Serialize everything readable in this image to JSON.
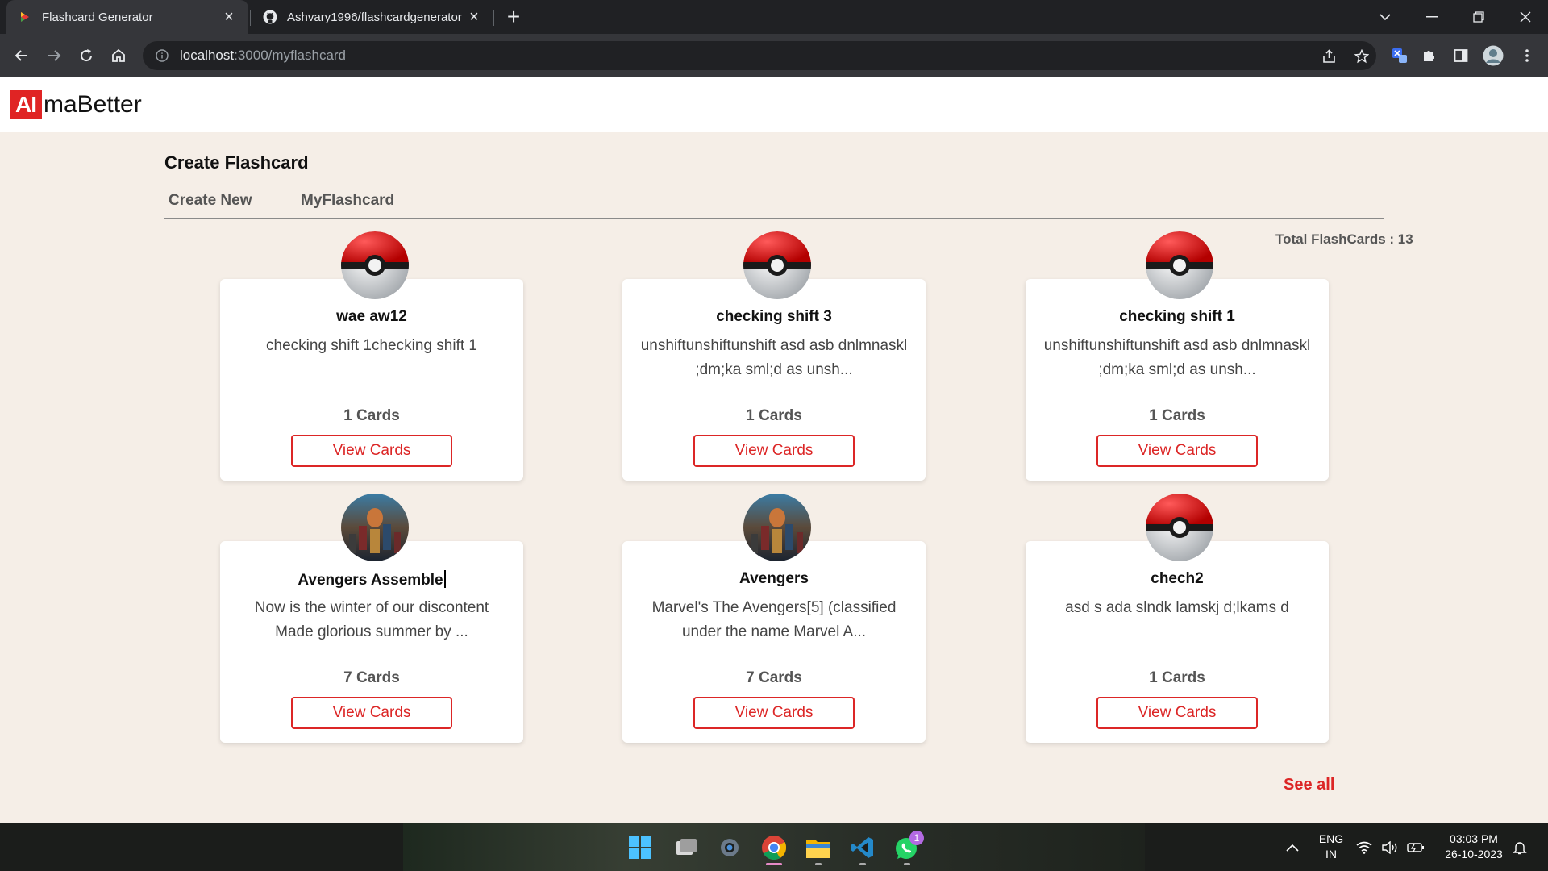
{
  "browser": {
    "tabs": [
      {
        "title": "Flashcard Generator",
        "active": true
      },
      {
        "title": "Ashvary1996/flashcardgenerator",
        "active": false
      }
    ],
    "url_host": "localhost",
    "url_path": ":3000/myflashcard"
  },
  "site": {
    "logo_mark": "AI",
    "logo_rest": "maBetter"
  },
  "page": {
    "title": "Create Flashcard",
    "nav": [
      "Create New",
      "MyFlashcard"
    ],
    "total_label": "Total FlashCards : 13",
    "see_all": "See all"
  },
  "cards": [
    {
      "name": "wae aw12",
      "description": "checking shift 1checking shift 1",
      "count": "1 Cards",
      "button": "View Cards",
      "avatar": "pokeball-icon"
    },
    {
      "name": "checking shift 3",
      "description": "unshiftunshiftunshift asd asb dnlmnaskl ;dm;ka sml;d as unsh...",
      "count": "1 Cards",
      "button": "View Cards",
      "avatar": "pokeball-icon"
    },
    {
      "name": "checking shift 1",
      "description": "unshiftunshiftunshift asd asb dnlmnaskl ;dm;ka sml;d as unsh...",
      "count": "1 Cards",
      "button": "View Cards",
      "avatar": "pokeball-icon"
    },
    {
      "name": "Avengers Assemble",
      "description": "Now is the winter of our discontent Made glorious summer by ...",
      "count": "7 Cards",
      "button": "View Cards",
      "avatar": "avengers-poster"
    },
    {
      "name": "Avengers",
      "description": "Marvel's The Avengers[5] (classified under the name Marvel A...",
      "count": "7 Cards",
      "button": "View Cards",
      "avatar": "avengers-poster"
    },
    {
      "name": "chech2",
      "description": "asd s ada slndk lamskj d;lkams d",
      "count": "1 Cards",
      "button": "View Cards",
      "avatar": "pokeball-icon"
    }
  ],
  "taskbar": {
    "lang_top": "ENG",
    "lang_bottom": "IN",
    "time": "03:03 PM",
    "date": "26-10-2023",
    "whatsapp_badge": "1"
  },
  "colors": {
    "accent": "#dc2626",
    "page_bg": "#f5eee7",
    "chrome_dark": "#202124",
    "chrome_toolbar": "#35363a"
  }
}
